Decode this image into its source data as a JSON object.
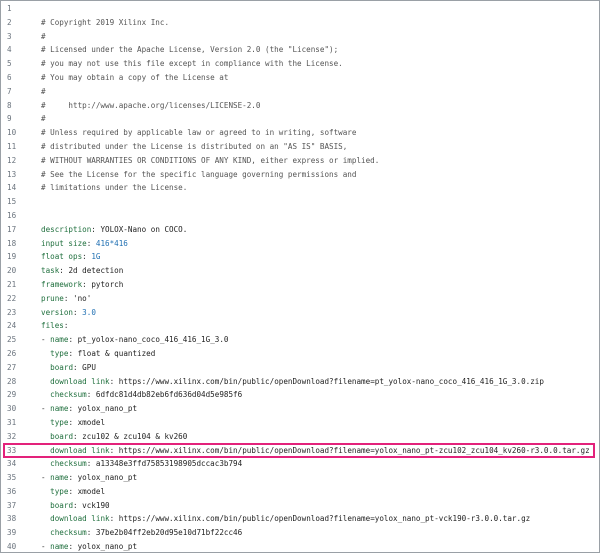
{
  "code": {
    "highlight_line": 33,
    "lines": [
      {
        "n": "1",
        "segs": []
      },
      {
        "n": "2",
        "segs": [
          {
            "t": "# Copyright 2019 Xilinx Inc.",
            "c": "comment"
          }
        ]
      },
      {
        "n": "3",
        "segs": [
          {
            "t": "#",
            "c": "comment"
          }
        ]
      },
      {
        "n": "4",
        "segs": [
          {
            "t": "# Licensed under the Apache License, Version 2.0 (the \"License\");",
            "c": "comment"
          }
        ]
      },
      {
        "n": "5",
        "segs": [
          {
            "t": "# you may not use this file except in compliance with the License.",
            "c": "comment"
          }
        ]
      },
      {
        "n": "6",
        "segs": [
          {
            "t": "# You may obtain a copy of the License at",
            "c": "comment"
          }
        ]
      },
      {
        "n": "7",
        "segs": [
          {
            "t": "#",
            "c": "comment"
          }
        ]
      },
      {
        "n": "8",
        "segs": [
          {
            "t": "#     http://www.apache.org/licenses/LICENSE-2.0",
            "c": "comment"
          }
        ]
      },
      {
        "n": "9",
        "segs": [
          {
            "t": "#",
            "c": "comment"
          }
        ]
      },
      {
        "n": "10",
        "segs": [
          {
            "t": "# Unless required by applicable law or agreed to in writing, software",
            "c": "comment"
          }
        ]
      },
      {
        "n": "11",
        "segs": [
          {
            "t": "# distributed under the License is distributed on an \"AS IS\" BASIS,",
            "c": "comment"
          }
        ]
      },
      {
        "n": "12",
        "segs": [
          {
            "t": "# WITHOUT WARRANTIES OR CONDITIONS OF ANY KIND, either express or implied.",
            "c": "comment"
          }
        ]
      },
      {
        "n": "13",
        "segs": [
          {
            "t": "# See the License for the specific language governing permissions and",
            "c": "comment"
          }
        ]
      },
      {
        "n": "14",
        "segs": [
          {
            "t": "# limitations under the License.",
            "c": "comment"
          }
        ]
      },
      {
        "n": "15",
        "segs": []
      },
      {
        "n": "16",
        "segs": []
      },
      {
        "n": "17",
        "segs": [
          {
            "t": "description",
            "c": "key"
          },
          {
            "t": ": ",
            "c": "sep"
          },
          {
            "t": "YOLOX-Nano on COCO.",
            "c": "plain"
          }
        ]
      },
      {
        "n": "18",
        "segs": [
          {
            "t": "input size",
            "c": "key"
          },
          {
            "t": ": ",
            "c": "sep"
          },
          {
            "t": "416*416",
            "c": "val"
          }
        ]
      },
      {
        "n": "19",
        "segs": [
          {
            "t": "float ops",
            "c": "key"
          },
          {
            "t": ": ",
            "c": "sep"
          },
          {
            "t": "1G",
            "c": "val"
          }
        ]
      },
      {
        "n": "20",
        "segs": [
          {
            "t": "task",
            "c": "key"
          },
          {
            "t": ": ",
            "c": "sep"
          },
          {
            "t": "2d detection",
            "c": "plain"
          }
        ]
      },
      {
        "n": "21",
        "segs": [
          {
            "t": "framework",
            "c": "key"
          },
          {
            "t": ": ",
            "c": "sep"
          },
          {
            "t": "pytorch",
            "c": "plain"
          }
        ]
      },
      {
        "n": "22",
        "segs": [
          {
            "t": "prune",
            "c": "key"
          },
          {
            "t": ": ",
            "c": "sep"
          },
          {
            "t": "'no'",
            "c": "plain"
          }
        ]
      },
      {
        "n": "23",
        "segs": [
          {
            "t": "version",
            "c": "key"
          },
          {
            "t": ": ",
            "c": "sep"
          },
          {
            "t": "3.0",
            "c": "val"
          }
        ]
      },
      {
        "n": "24",
        "segs": [
          {
            "t": "files",
            "c": "key"
          },
          {
            "t": ":",
            "c": "sep"
          }
        ]
      },
      {
        "n": "25",
        "segs": [
          {
            "t": "- ",
            "c": "sep"
          },
          {
            "t": "name",
            "c": "key"
          },
          {
            "t": ": ",
            "c": "sep"
          },
          {
            "t": "pt_yolox-nano_coco_416_416_1G_3.0",
            "c": "plain"
          }
        ]
      },
      {
        "n": "26",
        "segs": [
          {
            "t": "  ",
            "c": "sep"
          },
          {
            "t": "type",
            "c": "key"
          },
          {
            "t": ": ",
            "c": "sep"
          },
          {
            "t": "float & quantized",
            "c": "plain"
          }
        ]
      },
      {
        "n": "27",
        "segs": [
          {
            "t": "  ",
            "c": "sep"
          },
          {
            "t": "board",
            "c": "key"
          },
          {
            "t": ": ",
            "c": "sep"
          },
          {
            "t": "GPU",
            "c": "plain"
          }
        ]
      },
      {
        "n": "28",
        "segs": [
          {
            "t": "  ",
            "c": "sep"
          },
          {
            "t": "download link",
            "c": "key"
          },
          {
            "t": ": ",
            "c": "sep"
          },
          {
            "t": "https://www.xilinx.com/bin/public/openDownload?filename=pt_yolox-nano_coco_416_416_1G_3.0.zip",
            "c": "plain"
          }
        ]
      },
      {
        "n": "29",
        "segs": [
          {
            "t": "  ",
            "c": "sep"
          },
          {
            "t": "checksum",
            "c": "key"
          },
          {
            "t": ": ",
            "c": "sep"
          },
          {
            "t": "6dfdc81d4db82eb6fd636d04d5e985f6",
            "c": "plain"
          }
        ]
      },
      {
        "n": "30",
        "segs": [
          {
            "t": "- ",
            "c": "sep"
          },
          {
            "t": "name",
            "c": "key"
          },
          {
            "t": ": ",
            "c": "sep"
          },
          {
            "t": "yolox_nano_pt",
            "c": "plain"
          }
        ]
      },
      {
        "n": "31",
        "segs": [
          {
            "t": "  ",
            "c": "sep"
          },
          {
            "t": "type",
            "c": "key"
          },
          {
            "t": ": ",
            "c": "sep"
          },
          {
            "t": "xmodel",
            "c": "plain"
          }
        ]
      },
      {
        "n": "32",
        "segs": [
          {
            "t": "  ",
            "c": "sep"
          },
          {
            "t": "board",
            "c": "key"
          },
          {
            "t": ": ",
            "c": "sep"
          },
          {
            "t": "zcu102 & zcu104 & kv260",
            "c": "plain"
          }
        ]
      },
      {
        "n": "33",
        "segs": [
          {
            "t": "  ",
            "c": "sep"
          },
          {
            "t": "download link",
            "c": "key"
          },
          {
            "t": ": ",
            "c": "sep"
          },
          {
            "t": "https://www.xilinx.com/bin/public/openDownload?filename=yolox_nano_pt-zcu102_zcu104_kv260-r3.0.0.tar.gz",
            "c": "plain"
          }
        ]
      },
      {
        "n": "34",
        "segs": [
          {
            "t": "  ",
            "c": "sep"
          },
          {
            "t": "checksum",
            "c": "key"
          },
          {
            "t": ": ",
            "c": "sep"
          },
          {
            "t": "a13348e3ffd75853198905dccac3b794",
            "c": "plain"
          }
        ]
      },
      {
        "n": "35",
        "segs": [
          {
            "t": "- ",
            "c": "sep"
          },
          {
            "t": "name",
            "c": "key"
          },
          {
            "t": ": ",
            "c": "sep"
          },
          {
            "t": "yolox_nano_pt",
            "c": "plain"
          }
        ]
      },
      {
        "n": "36",
        "segs": [
          {
            "t": "  ",
            "c": "sep"
          },
          {
            "t": "type",
            "c": "key"
          },
          {
            "t": ": ",
            "c": "sep"
          },
          {
            "t": "xmodel",
            "c": "plain"
          }
        ]
      },
      {
        "n": "37",
        "segs": [
          {
            "t": "  ",
            "c": "sep"
          },
          {
            "t": "board",
            "c": "key"
          },
          {
            "t": ": ",
            "c": "sep"
          },
          {
            "t": "vck190",
            "c": "plain"
          }
        ]
      },
      {
        "n": "38",
        "segs": [
          {
            "t": "  ",
            "c": "sep"
          },
          {
            "t": "download link",
            "c": "key"
          },
          {
            "t": ": ",
            "c": "sep"
          },
          {
            "t": "https://www.xilinx.com/bin/public/openDownload?filename=yolox_nano_pt-vck190-r3.0.0.tar.gz",
            "c": "plain"
          }
        ]
      },
      {
        "n": "39",
        "segs": [
          {
            "t": "  ",
            "c": "sep"
          },
          {
            "t": "checksum",
            "c": "key"
          },
          {
            "t": ": ",
            "c": "sep"
          },
          {
            "t": "37be2b04ff2eb20d95e10d71bf22cc46",
            "c": "plain"
          }
        ]
      },
      {
        "n": "40",
        "segs": [
          {
            "t": "- ",
            "c": "sep"
          },
          {
            "t": "name",
            "c": "key"
          },
          {
            "t": ": ",
            "c": "sep"
          },
          {
            "t": "yolox_nano_pt",
            "c": "plain"
          }
        ]
      }
    ]
  },
  "colors": {
    "highlight_border": "#e3227b",
    "key": "#1f6f3d",
    "number": "#1f6fb2",
    "comment": "#555555",
    "line_number": "#6a737d"
  }
}
